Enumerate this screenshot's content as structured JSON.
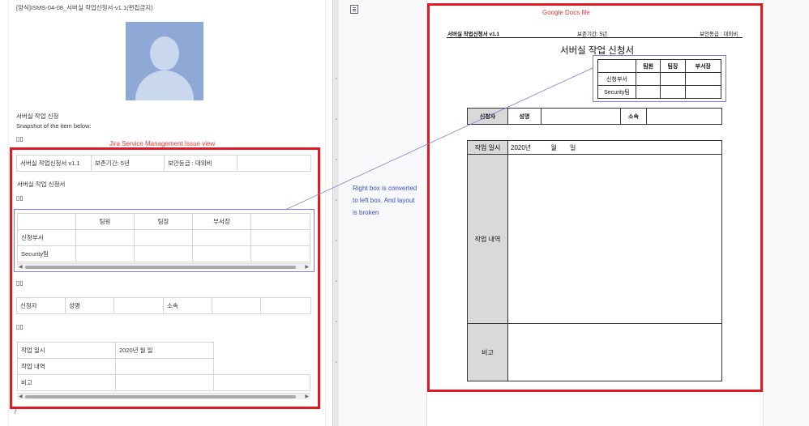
{
  "jira": {
    "title": "[양식]ISMS-04-08_서버실 작업신청서-v1.1(편집금지)",
    "section_heading": "서버실 작업 신청",
    "snapshot_text": "Snapshot of the item below:",
    "broken_glyph": "▯▯",
    "caption": "Jira Service Management Issue view",
    "header_row": [
      "서버실 작업신청서 v1.1",
      "보존기간: 5년",
      "보안등급 : 대외비"
    ],
    "doc_title": "서버실 작업 신청서",
    "approval_headers": [
      "팀원",
      "팀장",
      "부서장"
    ],
    "approval_rows": [
      "신청부서",
      "Security팀"
    ],
    "applicant_row": [
      "신청자",
      "성명",
      "소속"
    ],
    "work_rows": [
      {
        "label": "작업 일시",
        "value": "2020년 월 일"
      },
      {
        "label": "작업 내역",
        "value": ""
      },
      {
        "label": "비고",
        "value": ""
      }
    ],
    "footer_char": "/"
  },
  "docs": {
    "caption": "Google Docs file",
    "header_left": "서버실 작업신청서 v1.1",
    "header_center": "보존기간: 5년",
    "header_right": "보안등급 : 대외비",
    "title": "서버실 작업 신청서",
    "approval_headers": [
      "팀원",
      "팀장",
      "부서장"
    ],
    "approval_rows": [
      "신청부서",
      "Security팀"
    ],
    "applicant_row": [
      "신청자",
      "성명",
      "소속"
    ],
    "work_datetime_label": "작업 일시",
    "work_year": "2020년",
    "work_month": "월",
    "work_day": "일",
    "work_details_label": "작업 내역",
    "notes_label": "비고"
  },
  "annotation": "Right box is converted to left box. And layout is broken",
  "colors": {
    "highlight_red": "#e01b24",
    "annotation_blue": "#3c4cc8",
    "outline_purple": "#7b7fd6",
    "shade_gray": "#d9d9d9"
  },
  "icons": [
    "avatar-placeholder",
    "outline-icon",
    "scroll-left-arrow",
    "scroll-right-arrow"
  ]
}
